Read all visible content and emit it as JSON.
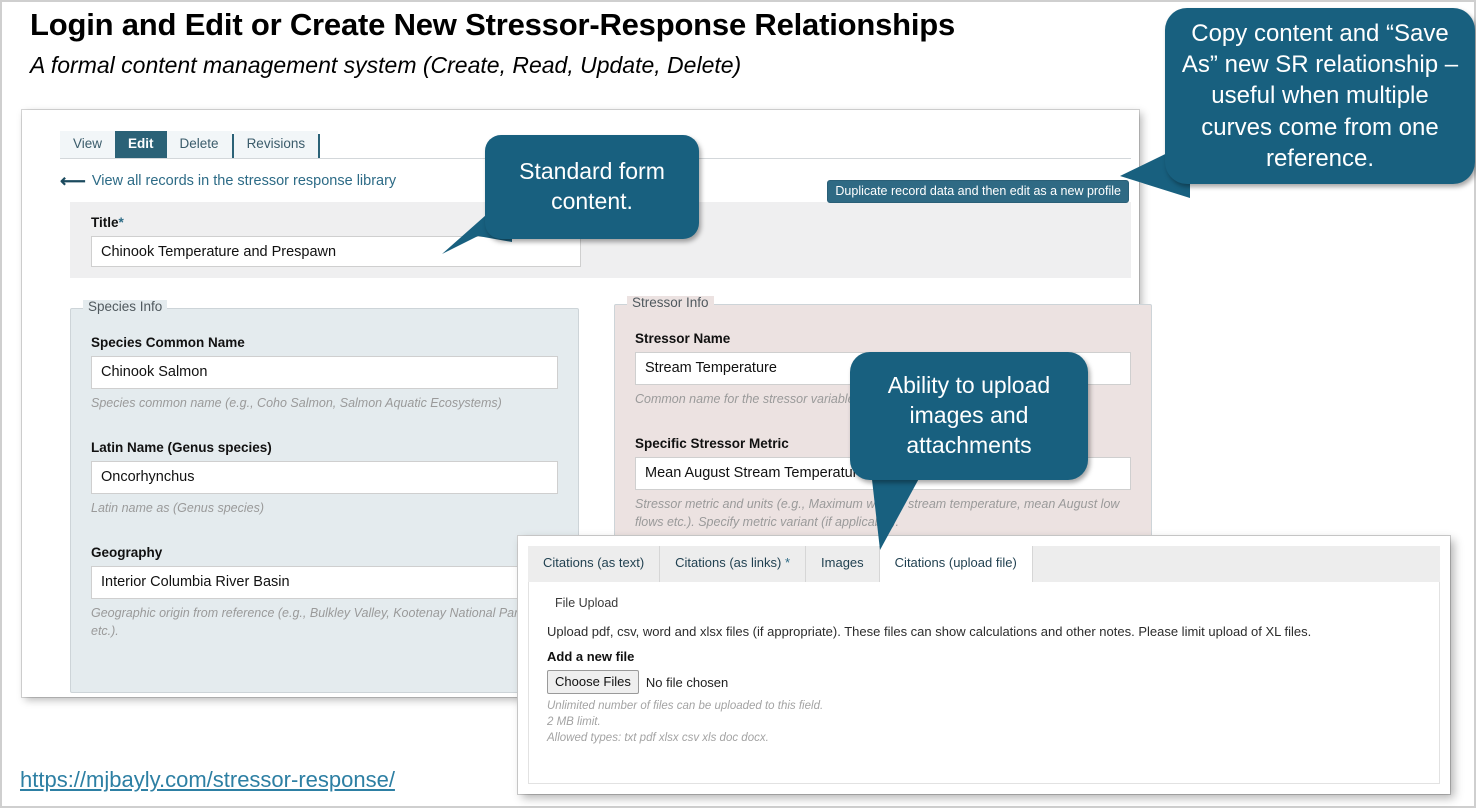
{
  "heading": {
    "title": "Login and Edit or Create New Stressor-Response Relationships",
    "subtitle": "A formal content management system (Create, Read, Update, Delete)"
  },
  "colors": {
    "callout_bg": "#18607f",
    "active_tab_bg": "#2b6277",
    "species_panel_bg": "#e4ebee",
    "stressor_panel_bg": "#ece2e1",
    "link": "#2d7fa3"
  },
  "admin_tabs": [
    {
      "label": "View",
      "active": false
    },
    {
      "label": "Edit",
      "active": true
    },
    {
      "label": "Delete",
      "active": false
    },
    {
      "label": "Revisions",
      "active": false
    }
  ],
  "back_link": {
    "icon": "left-arrow-icon",
    "label": "View all records in the stressor response library"
  },
  "duplicate_button": {
    "label": "Duplicate record data and then edit as a new profile"
  },
  "title_field": {
    "label": "Title",
    "required_marker": "*",
    "value": "Chinook Temperature and Prespawn"
  },
  "species_info": {
    "legend": "Species Info",
    "fields": [
      {
        "label": "Species Common Name",
        "value": "Chinook Salmon",
        "help": "Species common name (e.g., Coho Salmon, Salmon Aquatic Ecosystems)"
      },
      {
        "label": "Latin Name (Genus species)",
        "value": "Oncorhynchus",
        "help": "Latin name as (Genus species)"
      },
      {
        "label": "Geography",
        "value": "Interior Columbia River Basin",
        "help": "Geographic origin from reference (e.g., Bulkley Valley, Kootenay National Park, B etc.)."
      }
    ]
  },
  "stressor_info": {
    "legend": "Stressor Info",
    "fields": [
      {
        "label": "Stressor Name",
        "value": "Stream Temperature",
        "help": "Common name for the stressor variable (e."
      },
      {
        "label": "Specific Stressor Metric",
        "value": "Mean August Stream Temperature",
        "help": "Stressor metric and units (e.g., Maximum weekly          stream temperature, mean August low flows etc.). Specify metric variant (if applicable)."
      }
    ]
  },
  "citations_card": {
    "tabs": [
      {
        "label": "Citations (as text)",
        "required": false,
        "active": false
      },
      {
        "label": "Citations (as links)",
        "required": true,
        "active": false
      },
      {
        "label": "Images",
        "required": false,
        "active": false
      },
      {
        "label": "Citations (upload file)",
        "required": false,
        "active": true
      }
    ],
    "legend": "File Upload",
    "description": "Upload pdf, csv, word and xlsx files (if appropriate). These files can show calculations and other notes. Please limit upload of XL files.",
    "add_file_label": "Add a new file",
    "choose_files_button": "Choose Files",
    "no_file_text": "No file chosen",
    "notes": [
      "Unlimited number of files can be uploaded to this field.",
      "2 MB limit.",
      "Allowed types: txt pdf xlsx csv xls doc docx."
    ]
  },
  "callouts": {
    "standard_form": "Standard form content.",
    "copy_content": "Copy content and “Save As” new SR relationship – useful when multiple curves come from one reference.",
    "upload": "Ability to upload images and attachments"
  },
  "footer_link": "https://mjbayly.com/stressor-response/"
}
